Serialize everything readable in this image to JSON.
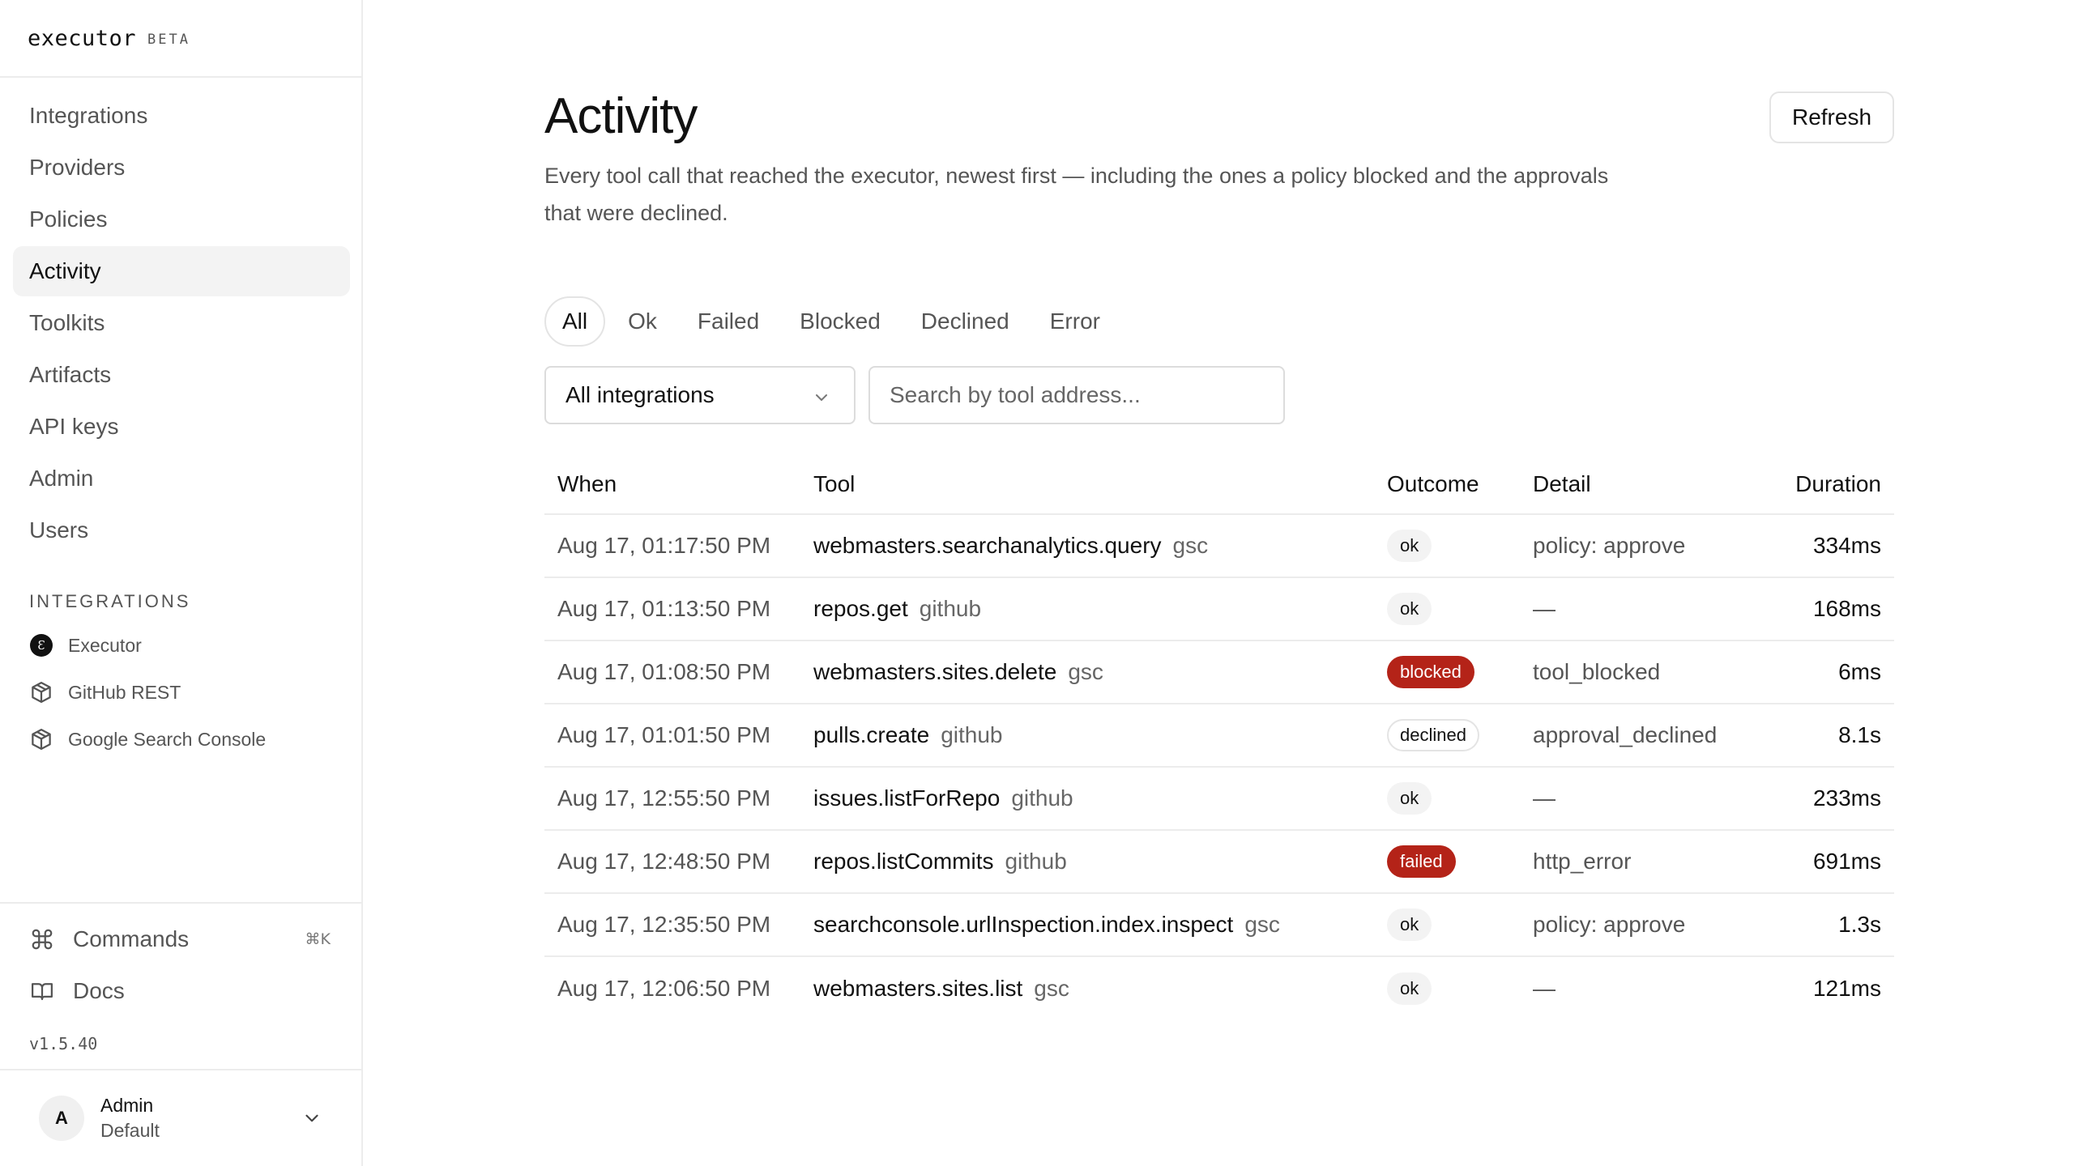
{
  "brand": {
    "name": "executor",
    "tag": "BETA"
  },
  "sidebar": {
    "nav": [
      {
        "label": "Integrations",
        "active": false
      },
      {
        "label": "Providers",
        "active": false
      },
      {
        "label": "Policies",
        "active": false
      },
      {
        "label": "Activity",
        "active": true
      },
      {
        "label": "Toolkits",
        "active": false
      },
      {
        "label": "Artifacts",
        "active": false
      },
      {
        "label": "API keys",
        "active": false
      },
      {
        "label": "Admin",
        "active": false
      },
      {
        "label": "Users",
        "active": false
      }
    ],
    "integrations_label": "INTEGRATIONS",
    "integrations": [
      {
        "label": "Executor",
        "icon": "executor-logo-icon"
      },
      {
        "label": "GitHub REST",
        "icon": "package-icon"
      },
      {
        "label": "Google Search Console",
        "icon": "package-icon"
      }
    ],
    "commands_label": "Commands",
    "commands_shortcut": "⌘K",
    "docs_label": "Docs",
    "version": "v1.5.40",
    "user": {
      "initial": "A",
      "name": "Admin",
      "org": "Default"
    }
  },
  "main": {
    "title": "Activity",
    "refresh_label": "Refresh",
    "description": "Every tool call that reached the executor, newest first — including the ones a policy blocked and the approvals that were declined.",
    "tabs": [
      {
        "label": "All",
        "active": true
      },
      {
        "label": "Ok",
        "active": false
      },
      {
        "label": "Failed",
        "active": false
      },
      {
        "label": "Blocked",
        "active": false
      },
      {
        "label": "Declined",
        "active": false
      },
      {
        "label": "Error",
        "active": false
      }
    ],
    "integration_filter": "All integrations",
    "search_placeholder": "Search by tool address...",
    "columns": {
      "when": "When",
      "tool": "Tool",
      "outcome": "Outcome",
      "detail": "Detail",
      "duration": "Duration"
    },
    "rows": [
      {
        "when": "Aug 17, 01:17:50 PM",
        "tool": "webmasters.searchanalytics.query",
        "integration": "gsc",
        "outcome": "ok",
        "detail": "policy: approve",
        "duration": "334ms"
      },
      {
        "when": "Aug 17, 01:13:50 PM",
        "tool": "repos.get",
        "integration": "github",
        "outcome": "ok",
        "detail": "—",
        "duration": "168ms"
      },
      {
        "when": "Aug 17, 01:08:50 PM",
        "tool": "webmasters.sites.delete",
        "integration": "gsc",
        "outcome": "blocked",
        "detail": "tool_blocked",
        "duration": "6ms"
      },
      {
        "when": "Aug 17, 01:01:50 PM",
        "tool": "pulls.create",
        "integration": "github",
        "outcome": "declined",
        "detail": "approval_declined",
        "duration": "8.1s"
      },
      {
        "when": "Aug 17, 12:55:50 PM",
        "tool": "issues.listForRepo",
        "integration": "github",
        "outcome": "ok",
        "detail": "—",
        "duration": "233ms"
      },
      {
        "when": "Aug 17, 12:48:50 PM",
        "tool": "repos.listCommits",
        "integration": "github",
        "outcome": "failed",
        "detail": "http_error",
        "duration": "691ms"
      },
      {
        "when": "Aug 17, 12:35:50 PM",
        "tool": "searchconsole.urlInspection.index.inspect",
        "integration": "gsc",
        "outcome": "ok",
        "detail": "policy: approve",
        "duration": "1.3s"
      },
      {
        "when": "Aug 17, 12:06:50 PM",
        "tool": "webmasters.sites.list",
        "integration": "gsc",
        "outcome": "ok",
        "detail": "—",
        "duration": "121ms"
      }
    ]
  },
  "colors": {
    "danger": "#b42318",
    "muted_text": "#555555",
    "border": "#ececec",
    "active_bg": "#f3f3f3"
  }
}
